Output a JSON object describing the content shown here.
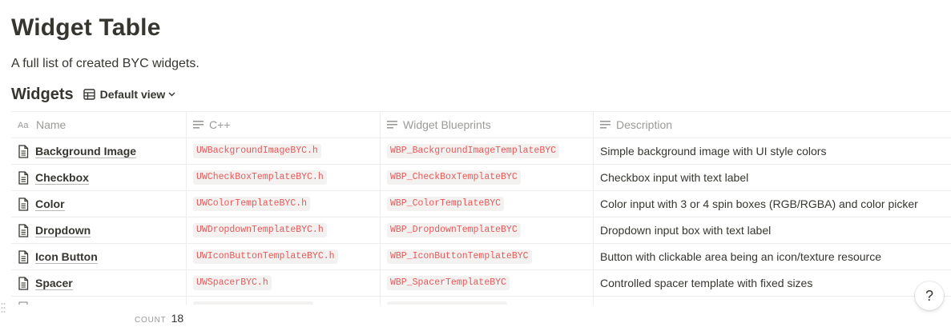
{
  "page": {
    "title": "Widget Table",
    "subtitle": "A full list of created BYC widgets."
  },
  "database": {
    "title": "Widgets",
    "view_label": "Default view"
  },
  "table": {
    "columns": [
      {
        "label": "Name",
        "icon": "title-property-icon"
      },
      {
        "label": "C++",
        "icon": "text-property-icon"
      },
      {
        "label": "Widget Blueprints",
        "icon": "text-property-icon"
      },
      {
        "label": "Description",
        "icon": "text-property-icon"
      }
    ],
    "rows": [
      {
        "name": "Background Image",
        "cpp": "UWBackgroundImageBYC.h",
        "blueprint": "WBP_BackgroundImageTemplateBYC",
        "description": "Simple background image with UI style colors"
      },
      {
        "name": "Checkbox",
        "cpp": "UWCheckBoxTemplateBYC.h",
        "blueprint": "WBP_CheckBoxTemplateBYC",
        "description": "Checkbox input with text label"
      },
      {
        "name": "Color",
        "cpp": "UWColorTemplateBYC.h",
        "blueprint": "WBP_ColorTemplateBYC",
        "description": "Color input with 3 or 4 spin boxes (RGB/RGBA) and color picker"
      },
      {
        "name": "Dropdown",
        "cpp": "UWDropdownTemplateBYC.h",
        "blueprint": "WBP_DropdownTemplateBYC",
        "description": "Dropdown input box with text label"
      },
      {
        "name": "Icon Button",
        "cpp": "UWIconButtonTemplateBYC.h",
        "blueprint": "WBP_IconButtonTemplateBYC",
        "description": "Button with clickable area being an icon/texture resource"
      },
      {
        "name": "Spacer",
        "cpp": "UWSpacerBYC.h",
        "blueprint": "WBP_SpacerTemplateBYC",
        "description": "Controlled spacer template with fixed sizes"
      }
    ]
  },
  "footer": {
    "count_label": "COUNT",
    "count_value": "18"
  },
  "help": {
    "label": "?"
  },
  "colors": {
    "text": "#37352f",
    "muted": "#9b9a97",
    "code_text": "#eb5757",
    "code_bg": "#f3f2f1",
    "border": "#ededec"
  }
}
